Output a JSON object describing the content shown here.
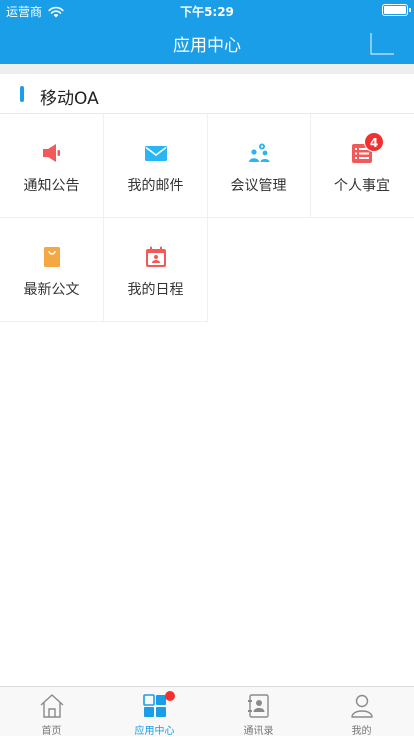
{
  "status_bar": {
    "carrier": "运营商",
    "time": "下午5:29"
  },
  "header": {
    "title": "应用中心"
  },
  "section": {
    "title": "移动OA"
  },
  "apps": [
    {
      "label": "通知公告",
      "icon": "megaphone-icon",
      "color": "#f25a5a"
    },
    {
      "label": "我的邮件",
      "icon": "mail-icon",
      "color": "#29b6f2"
    },
    {
      "label": "会议管理",
      "icon": "meeting-icon",
      "color": "#29b6f2"
    },
    {
      "label": "个人事宜",
      "icon": "task-list-icon",
      "color": "#f25a5a",
      "badge": "4"
    },
    {
      "label": "最新公文",
      "icon": "document-bag-icon",
      "color": "#f5a742"
    },
    {
      "label": "我的日程",
      "icon": "calendar-icon",
      "color": "#f25a5a"
    }
  ],
  "tabbar": {
    "active": "应用中心",
    "tabs": [
      {
        "label": "首页",
        "icon": "home-icon"
      },
      {
        "label": "应用中心",
        "icon": "apps-grid-icon"
      },
      {
        "label": "通讯录",
        "icon": "contacts-icon"
      },
      {
        "label": "我的",
        "icon": "profile-icon"
      }
    ]
  },
  "colors": {
    "primary": "#1a9ee8",
    "badge": "#f23030"
  }
}
